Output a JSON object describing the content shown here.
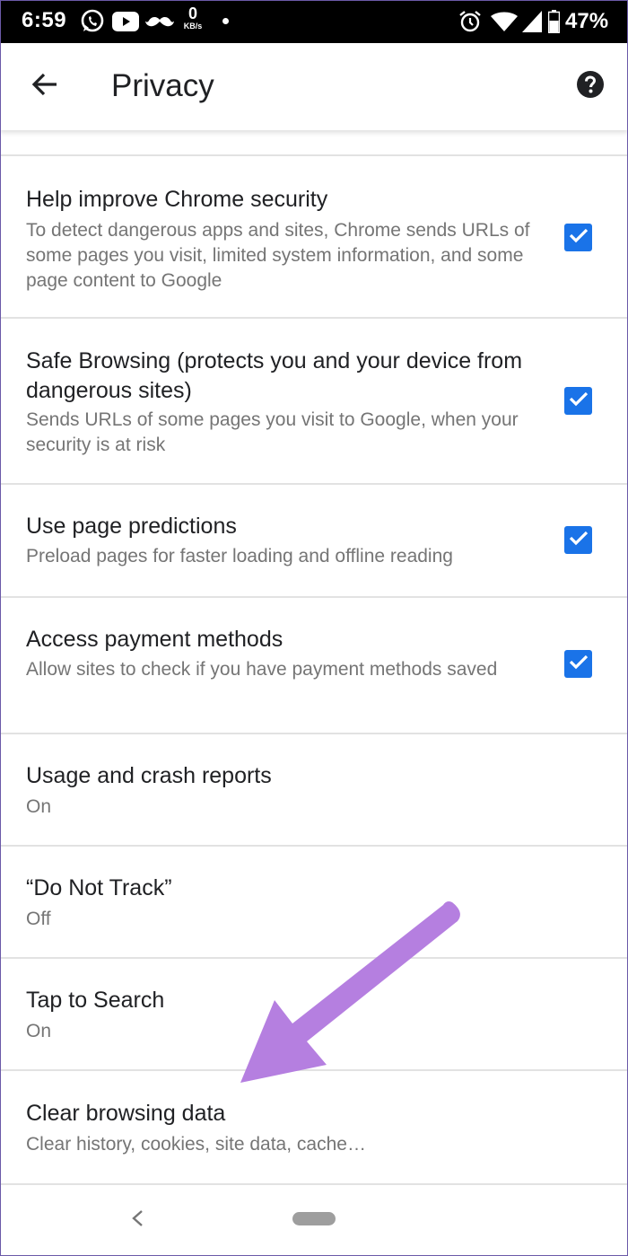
{
  "status_bar": {
    "time": "6:59",
    "net_speed_value": "0",
    "net_speed_unit": "KB/s",
    "battery": "47%",
    "icons": [
      "whatsapp-icon",
      "youtube-icon",
      "mustache-icon",
      "alarm-icon",
      "wifi-icon",
      "signal-icon",
      "battery-icon"
    ]
  },
  "toolbar": {
    "title": "Privacy",
    "back_icon": "arrow-left-icon",
    "help_icon": "help-circle-icon"
  },
  "settings": [
    {
      "title": "Help improve Chrome security",
      "subtitle": "To detect dangerous apps and sites, Chrome sends URLs of some pages you visit, limited system information, and some page content to Google",
      "checked": true
    },
    {
      "title": "Safe Browsing (protects you and your device from dangerous sites)",
      "subtitle": "Sends URLs of some pages you visit to Google, when your security is at risk",
      "checked": true
    },
    {
      "title": "Use page predictions",
      "subtitle": "Preload pages for faster loading and offline reading",
      "checked": true
    },
    {
      "title": "Access payment methods",
      "subtitle": "Allow sites to check if you have payment methods saved",
      "checked": true
    },
    {
      "title": "Usage and crash reports",
      "subtitle": "On"
    },
    {
      "title": "“Do Not Track”",
      "subtitle": "Off"
    },
    {
      "title": "Tap to Search",
      "subtitle": "On"
    },
    {
      "title": "Clear browsing data",
      "subtitle": "Clear history, cookies, site data, cache…"
    }
  ],
  "colors": {
    "checkbox": "#1a73e8",
    "annotation_arrow": "#b57fe0",
    "title_text": "#202124",
    "subtitle_text": "#757575"
  },
  "nav_bar": {
    "back_icon": "nav-back-icon",
    "home_icon": "home-pill-icon"
  },
  "annotation": {
    "icon": "pointer-arrow-icon"
  }
}
